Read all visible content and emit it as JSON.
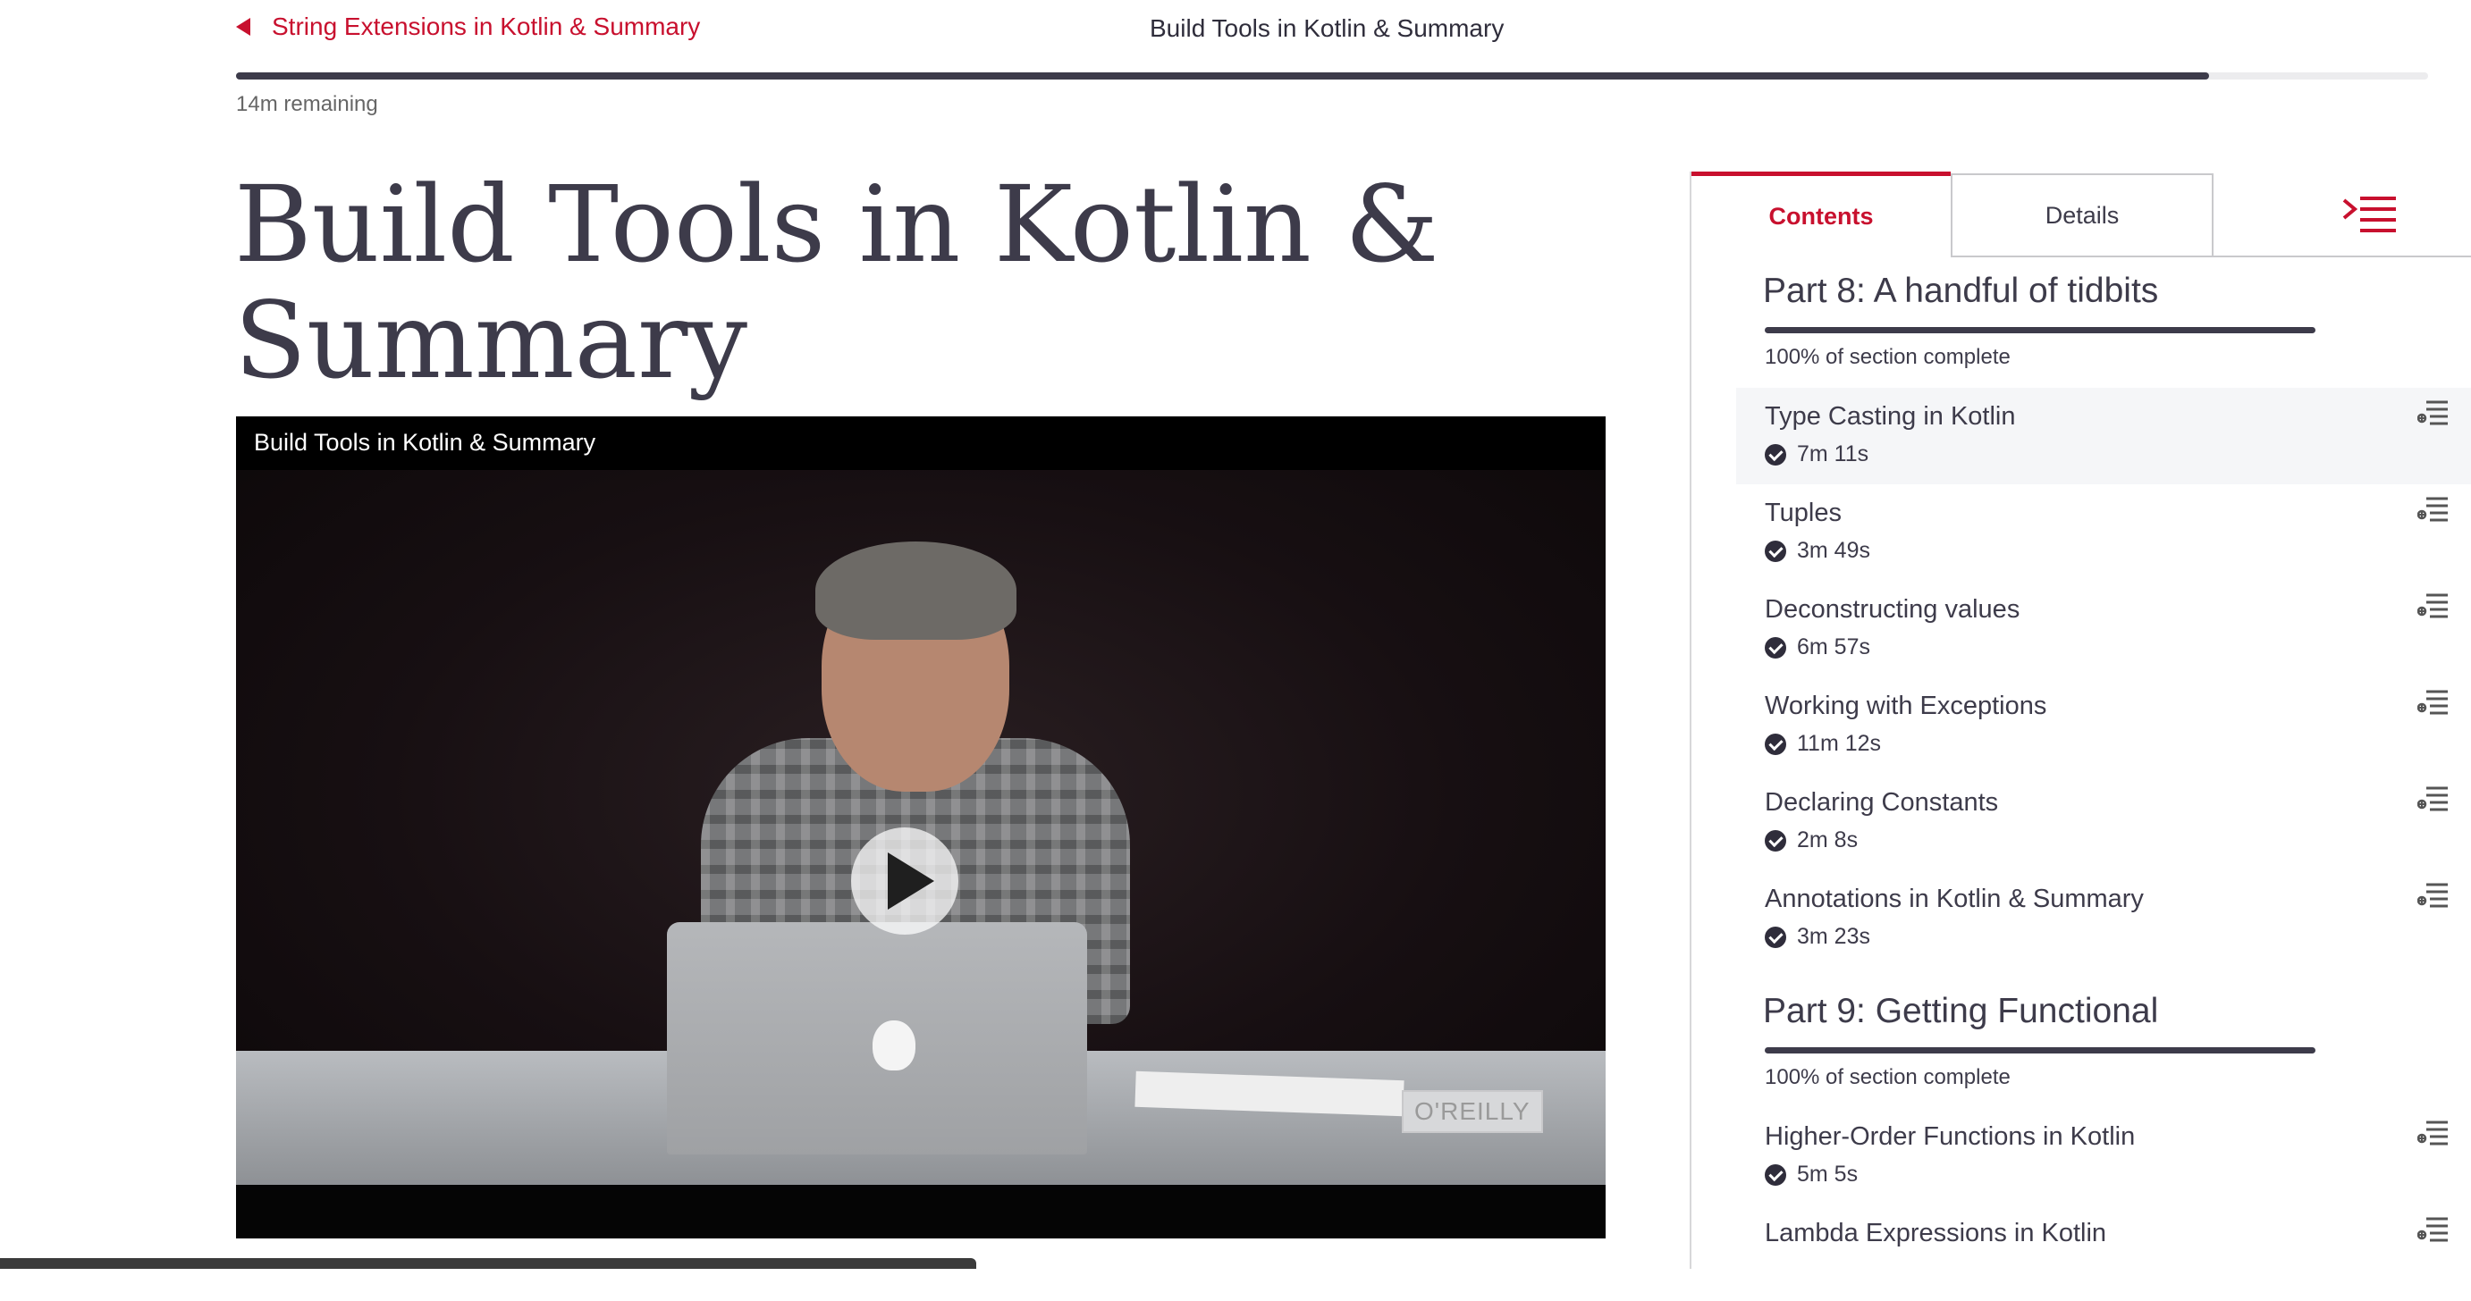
{
  "nav": {
    "prev_label": "String Extensions in Kotlin & Summary",
    "current_title": "Build Tools in Kotlin & Summary",
    "remaining": "14m remaining",
    "progress_fraction": 0.9
  },
  "page_title": "Build Tools in Kotlin & Summary",
  "video": {
    "title": "Build Tools in Kotlin & Summary",
    "watermark": "O'REILLY"
  },
  "sidebar": {
    "tabs": {
      "contents": "Contents",
      "details": "Details"
    },
    "sections": [
      {
        "title": "Part 8: A handful of tidbits",
        "status": "100% of section complete",
        "lessons": [
          {
            "title": "Type Casting in Kotlin",
            "duration": "7m 11s"
          },
          {
            "title": "Tuples",
            "duration": "3m 49s"
          },
          {
            "title": "Deconstructing values",
            "duration": "6m 57s"
          },
          {
            "title": "Working with Exceptions",
            "duration": "11m 12s"
          },
          {
            "title": "Declaring Constants",
            "duration": "2m 8s"
          },
          {
            "title": "Annotations in Kotlin & Summary",
            "duration": "3m 23s"
          }
        ]
      },
      {
        "title": "Part 9: Getting Functional",
        "status": "100% of section complete",
        "lessons": [
          {
            "title": "Higher-Order Functions in Kotlin",
            "duration": "5m 5s"
          },
          {
            "title": "Lambda Expressions in Kotlin",
            "duration": ""
          }
        ]
      }
    ]
  },
  "colors": {
    "accent": "#c8102e",
    "text": "#3d3b4a"
  }
}
